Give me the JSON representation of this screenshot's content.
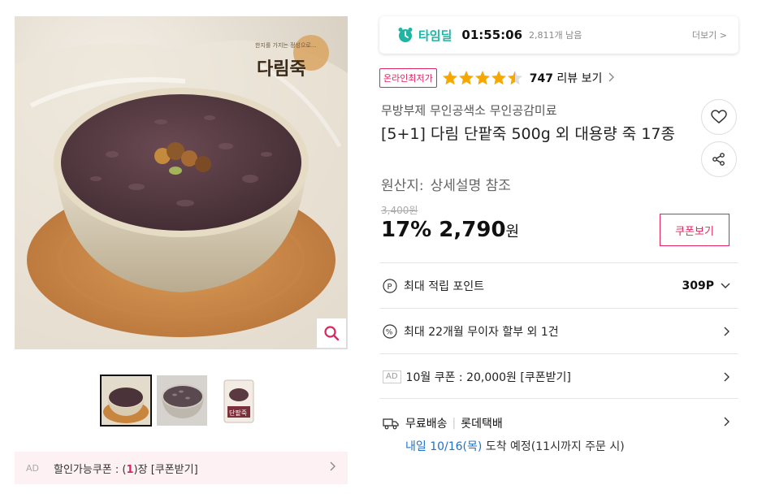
{
  "gallery": {
    "brand_logo_text": "다림죽",
    "logo_tagline": "한지를 가지는 정성으로...",
    "zoom_icon": "search-icon",
    "thumbnails": [
      {
        "name": "thumb-1",
        "active": true
      },
      {
        "name": "thumb-2",
        "active": false
      },
      {
        "name": "thumb-3",
        "active": false
      }
    ],
    "package_label": "단팥죽"
  },
  "coupon_bar": {
    "ad_label": "AD",
    "prefix": "할인가능쿠폰 : (",
    "count": "1",
    "suffix": ")장 [쿠폰받기]"
  },
  "timedeal": {
    "icon": "alarm-clock-icon",
    "label": "타임딜",
    "timer": "01:55:06",
    "remaining": "2,811개 남음",
    "more": "더보기 >"
  },
  "rating": {
    "badge": "온라인최저가",
    "stars": 4.5,
    "count": "747",
    "review_link": "리뷰 보기"
  },
  "product": {
    "subtitle": "무방부제 무인공색소 무인공감미료",
    "title": "[5+1] 다림 단팥죽 500g 외 대용량 죽 17종",
    "origin_label": "원산지:",
    "origin_value": "상세설명 참조"
  },
  "price": {
    "original": "3,400원",
    "discount": "17%",
    "sale": "2,790",
    "currency": "원",
    "coupon_button": "쿠폰보기"
  },
  "rows": {
    "points_label": "최대 적립 포인트",
    "points_value": "309P",
    "installment": "최대 22개월 무이자 할부 외 1건",
    "ad_label": "AD",
    "coupon_event": "10월 쿠폰 : 20,000원 [쿠폰받기]",
    "shipping_free": "무료배송",
    "courier": "롯데택배",
    "delivery_date": "내일 10/16(목)",
    "delivery_rest": " 도착 예정(11시까지 주문 시)"
  },
  "colors": {
    "accent": "#e0245e",
    "timedeal": "#1fb5a3",
    "star": "#f6a800",
    "delivery": "#1e72c8"
  }
}
